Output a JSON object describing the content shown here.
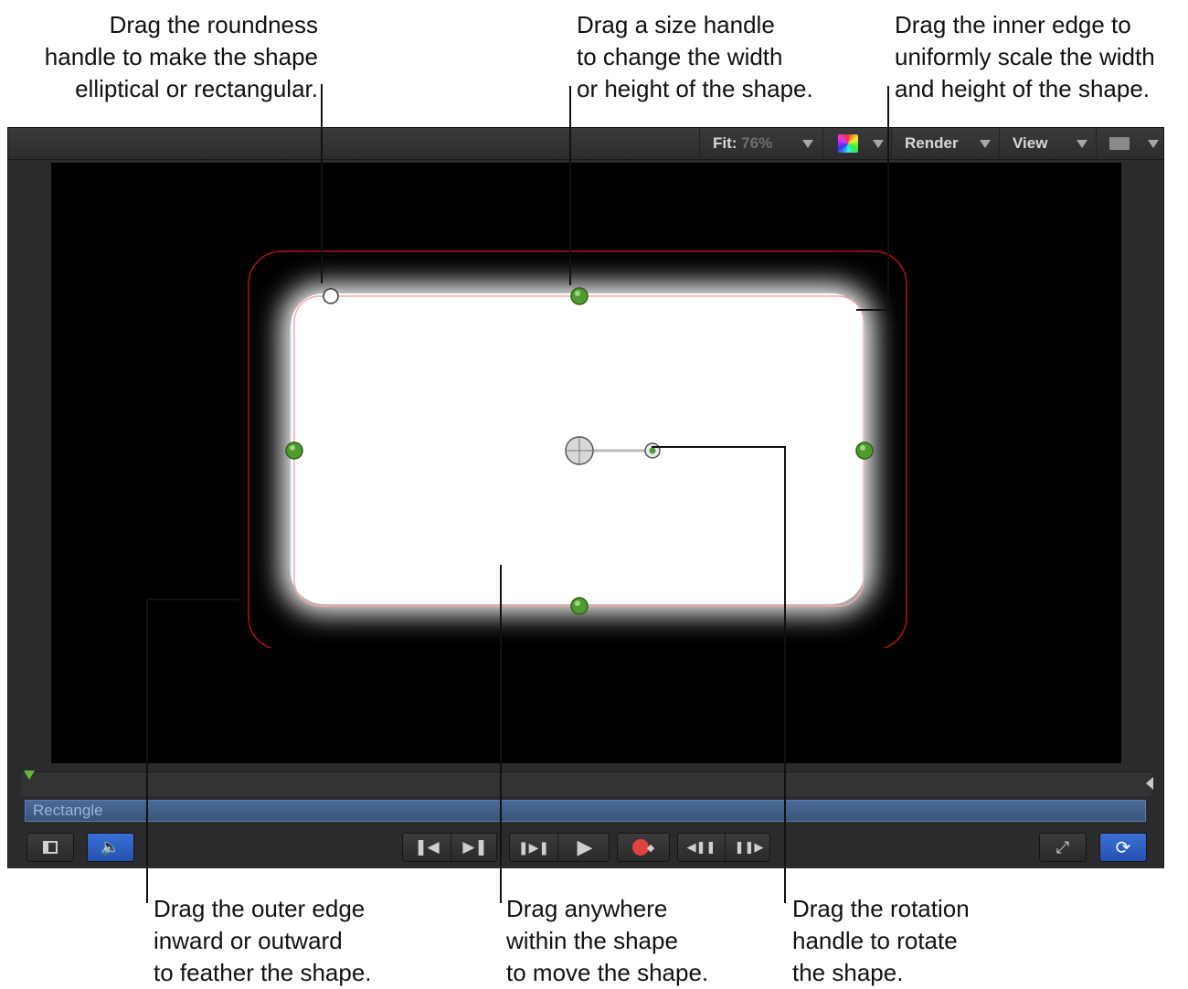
{
  "callouts": {
    "roundness": "Drag the roundness\nhandle to make the shape\nelliptical or rectangular.",
    "size_handle": "Drag a size handle\nto change the width\nor height of the shape.",
    "inner_edge": "Drag the inner edge to\nuniformly scale the width\nand height of the shape.",
    "outer_edge": "Drag the outer edge\ninward or outward\nto feather the shape.",
    "move": "Drag anywhere\nwithin the shape\nto move the shape.",
    "rotation": "Drag the rotation\nhandle to rotate\nthe shape."
  },
  "toolbar": {
    "fit_label": "Fit:",
    "fit_value": "76%",
    "render_label": "Render",
    "view_label": "View"
  },
  "timeline": {
    "track_label": "Rectangle"
  },
  "colors": {
    "handle_green": "#4f9b2e",
    "shape_edge": "#b0141a",
    "active_button": "#2f62c6"
  },
  "icons": [
    "color-channels-icon",
    "layout-icon",
    "audio-icon",
    "go-to-start-icon",
    "go-to-end-icon",
    "play-range-icon",
    "play-icon",
    "record-icon",
    "previous-frame-icon",
    "next-frame-icon",
    "fullscreen-icon",
    "loop-icon"
  ]
}
